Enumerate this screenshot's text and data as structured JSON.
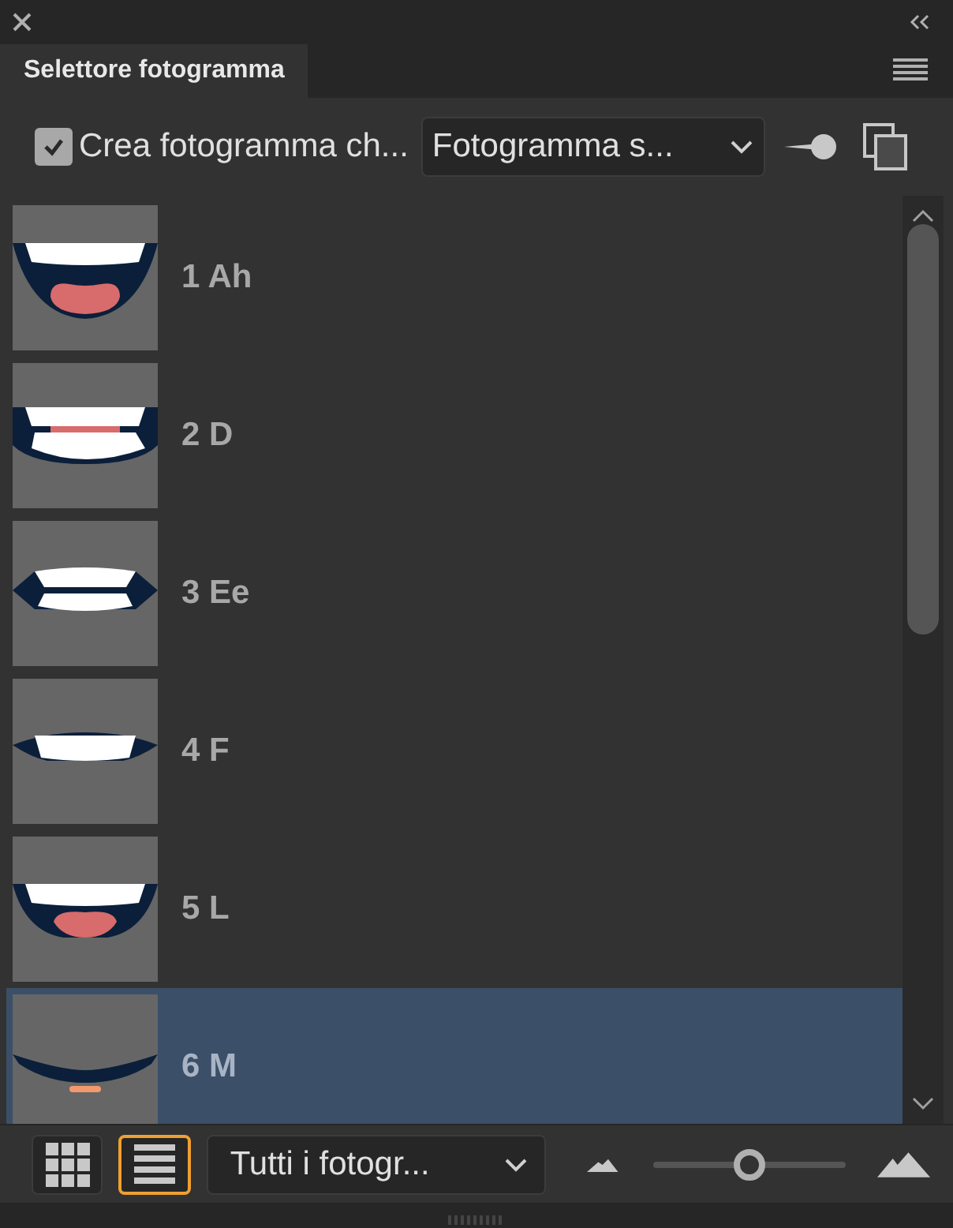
{
  "panel": {
    "tab": "Selettore fotogramma"
  },
  "toolbar": {
    "checkbox": {
      "label": "Crea fotogramma ch...",
      "checked": true
    },
    "dropdown": {
      "value": "Fotogramma s..."
    }
  },
  "frames": [
    {
      "label": "1 Ah",
      "kind": "ah",
      "selected": false
    },
    {
      "label": "2 D",
      "kind": "d",
      "selected": false
    },
    {
      "label": "3 Ee",
      "kind": "ee",
      "selected": false
    },
    {
      "label": "4 F",
      "kind": "f",
      "selected": false
    },
    {
      "label": "5 L",
      "kind": "l",
      "selected": false
    },
    {
      "label": "6 M",
      "kind": "m",
      "selected": true
    }
  ],
  "bottom_bar": {
    "view_buttons": [
      {
        "kind": "grid",
        "selected": false
      },
      {
        "kind": "list",
        "selected": true
      }
    ],
    "filter": {
      "value": "Tutti i fotogr..."
    },
    "size_slider": {
      "level": 0.5
    }
  }
}
